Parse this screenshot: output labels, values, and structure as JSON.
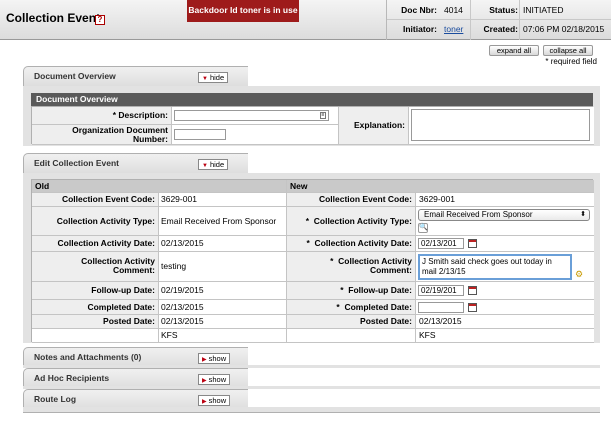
{
  "header": {
    "title": "Collection Event",
    "help_icon": "?",
    "backdoor_prefix": "Backdoor Id",
    "backdoor_user": "toner",
    "backdoor_suffix": "is in use",
    "doc_nbr_label": "Doc Nbr:",
    "doc_nbr": "4014",
    "status_label": "Status:",
    "status": "INITIATED",
    "initiator_label": "Initiator:",
    "initiator": "toner",
    "created_label": "Created:",
    "created": "07:06 PM 02/18/2015"
  },
  "toolbar": {
    "expand_all": "expand all",
    "collapse_all": "collapse all",
    "required_note": "* required field"
  },
  "document_overview": {
    "tab_label": "Document Overview",
    "toggle": "hide",
    "section_title": "Document Overview",
    "description_label": "* Description:",
    "org_doc_label_1": "Organization Document",
    "org_doc_label_2": "Number:",
    "explanation_label": "Explanation:",
    "description_value": "",
    "org_doc_value": "",
    "explanation_value": ""
  },
  "edit_collection_event": {
    "tab_label": "Edit Collection Event",
    "toggle": "hide",
    "old_header": "Old",
    "new_header": "New",
    "labels": {
      "code": "Collection Event Code:",
      "activity_type": "Collection Activity Type:",
      "activity_date": "Collection Activity Date:",
      "activity_comment_1": "Collection Activity",
      "activity_comment_2": "Comment:",
      "followup_date": "Follow-up Date:",
      "completed_date": "Completed Date:",
      "posted_date": "Posted Date:"
    },
    "required_star": "*",
    "old": {
      "code": "3629-001",
      "activity_type": "Email Received From Sponsor",
      "activity_date": "02/13/2015",
      "activity_comment": "testing",
      "followup_date": "02/19/2015",
      "completed_date": "02/13/2015",
      "posted_date": "02/13/2015",
      "user": "KFS"
    },
    "new": {
      "code": "3629-001",
      "activity_type": "Email Received From Sponsor",
      "activity_date": "02/13/201",
      "activity_comment": "J Smith said check goes out today in mail 2/13/15",
      "followup_date": "02/19/201",
      "completed_date": "",
      "posted_date": "02/13/2015",
      "user": "KFS"
    }
  },
  "other_tabs": {
    "notes": "Notes and Attachments (0)",
    "adhoc": "Ad Hoc Recipients",
    "route_log": "Route Log",
    "toggle": "show"
  },
  "colors": {
    "backdoor_bg": "#9e1b1b",
    "section_bar": "#5a5a5a",
    "link": "#1a4c9e"
  }
}
